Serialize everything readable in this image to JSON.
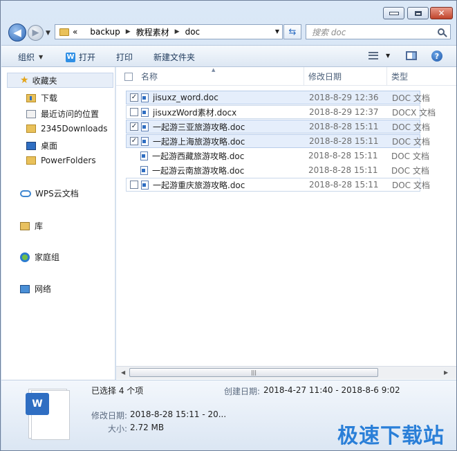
{
  "nav": {
    "back_glyph": "◀",
    "forward_glyph": "▶",
    "breadcrumb_overflow": "«",
    "breadcrumbs": [
      "backup",
      "教程素材",
      "doc"
    ],
    "search_placeholder": "搜索 doc"
  },
  "toolbar": {
    "organize": "组织",
    "open": "打开",
    "print": "打印",
    "new_folder": "新建文件夹"
  },
  "sidebar": {
    "favorites": "收藏夹",
    "items": [
      "下载",
      "最近访问的位置",
      "2345Downloads",
      "桌面",
      "PowerFolders"
    ],
    "wps_cloud": "WPS云文档",
    "library": "库",
    "homegroup": "家庭组",
    "network": "网络"
  },
  "columns": {
    "name": "名称",
    "modified": "修改日期",
    "type": "类型"
  },
  "files": [
    {
      "name": "jisuxz_word.doc",
      "date": "2018-8-29 12:36",
      "type": "DOC 文档",
      "checked": true
    },
    {
      "name": "jisuxzWord素材.docx",
      "date": "2018-8-29 12:37",
      "type": "DOCX 文档",
      "checked": false
    },
    {
      "name": "一起游三亚旅游攻略.doc",
      "date": "2018-8-28 15:11",
      "type": "DOC 文档",
      "checked": true
    },
    {
      "name": "一起游上海旅游攻略.doc",
      "date": "2018-8-28 15:11",
      "type": "DOC 文档",
      "checked": true
    },
    {
      "name": "一起游西藏旅游攻略.doc",
      "date": "2018-8-28 15:11",
      "type": "DOC 文档",
      "checked": false
    },
    {
      "name": "一起游云南旅游攻略.doc",
      "date": "2018-8-28 15:11",
      "type": "DOC 文档",
      "checked": false
    },
    {
      "name": "一起游重庆旅游攻略.doc",
      "date": "2018-8-28 15:11",
      "type": "DOC 文档",
      "checked": false
    }
  ],
  "details": {
    "selected_count": "已选择 4 个项",
    "created_label": "创建日期:",
    "created_value": "2018-4-27 11:40 - 2018-8-6 9:02",
    "modified_label": "修改日期:",
    "modified_value": "2018-8-28 15:11 - 20...",
    "size_label": "大小:",
    "size_value": "2.72 MB"
  },
  "watermark": "极速下载站",
  "colors": {
    "accent": "#2f6ec2",
    "selection": "#e5eefb",
    "close_button": "#c0442c",
    "watermark": "#2a7fd8"
  },
  "icons": {
    "back": "back-arrow-icon",
    "forward": "forward-arrow-icon",
    "refresh": "refresh-icon",
    "search": "search-icon",
    "help": "help-icon",
    "word": "word-doc-icon"
  }
}
